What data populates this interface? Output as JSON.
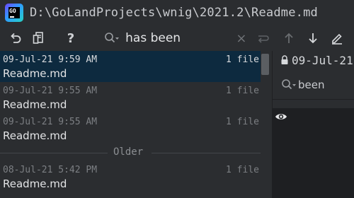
{
  "window": {
    "title": "D:\\GoLandProjects\\wnig\\2021.2\\Readme.md",
    "app_icon_letters": "GO"
  },
  "toolbar": {
    "undo_icon": "revert-icon",
    "diff_icon": "show-diff-icon",
    "help_label": "?"
  },
  "search": {
    "value": "has been",
    "clear_label": "×"
  },
  "navigation": {
    "prev_icon": "arrow-up-icon",
    "next_icon": "arrow-down-icon",
    "edit_icon": "edit-icon"
  },
  "history": {
    "rows": [
      {
        "date": "09-Jul-21 9:59 AM",
        "count": "1 file",
        "file": "Readme.md",
        "selected": true
      },
      {
        "date": "09-Jul-21 9:55 AM",
        "count": "1 file",
        "file": "Readme.md",
        "selected": false
      },
      {
        "date": "09-Jul-21 9:55 AM",
        "count": "1 file",
        "file": "Readme.md",
        "selected": false
      }
    ],
    "separator_label": "Older",
    "older_rows": [
      {
        "date": "08-Jul-21 5:42 PM",
        "count": "1 file",
        "file": "Readme.md",
        "selected": false
      }
    ]
  },
  "preview": {
    "date": "09-Jul-21",
    "search_text": "been"
  },
  "colors": {
    "background": "#2b2d30",
    "selection": "#0d2a3f",
    "editor_background": "#1e1f22"
  }
}
